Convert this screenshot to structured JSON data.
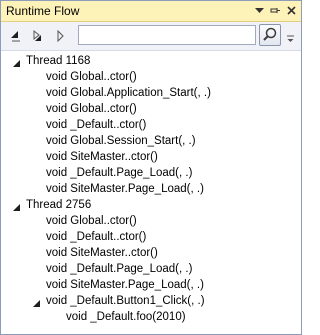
{
  "window": {
    "title": "Runtime Flow"
  },
  "titlebar_buttons": {
    "dropdown": "chevron-down-icon",
    "pin": "pin-icon",
    "close": "close-icon"
  },
  "toolbar": {
    "search": {
      "value": "",
      "placeholder": ""
    }
  },
  "tree": {
    "threads": [
      {
        "label": "Thread 1168",
        "expanded": true,
        "calls": [
          "void Global..ctor()",
          "void Global.Application_Start(, .)",
          "void Global..ctor()",
          "void _Default..ctor()",
          "void Global.Session_Start(, .)",
          "void SiteMaster..ctor()",
          "void _Default.Page_Load(, .)",
          "void SiteMaster.Page_Load(, .)"
        ]
      },
      {
        "label": "Thread 2756",
        "expanded": true,
        "calls": [
          "void Global..ctor()",
          "void _Default..ctor()",
          "void SiteMaster..ctor()",
          "void _Default.Page_Load(, .)",
          "void SiteMaster.Page_Load(, .)"
        ],
        "expanded_call": {
          "label": "void _Default.Button1_Click(, .)",
          "children": [
            "void _Default.foo(2010)"
          ]
        }
      }
    ]
  }
}
